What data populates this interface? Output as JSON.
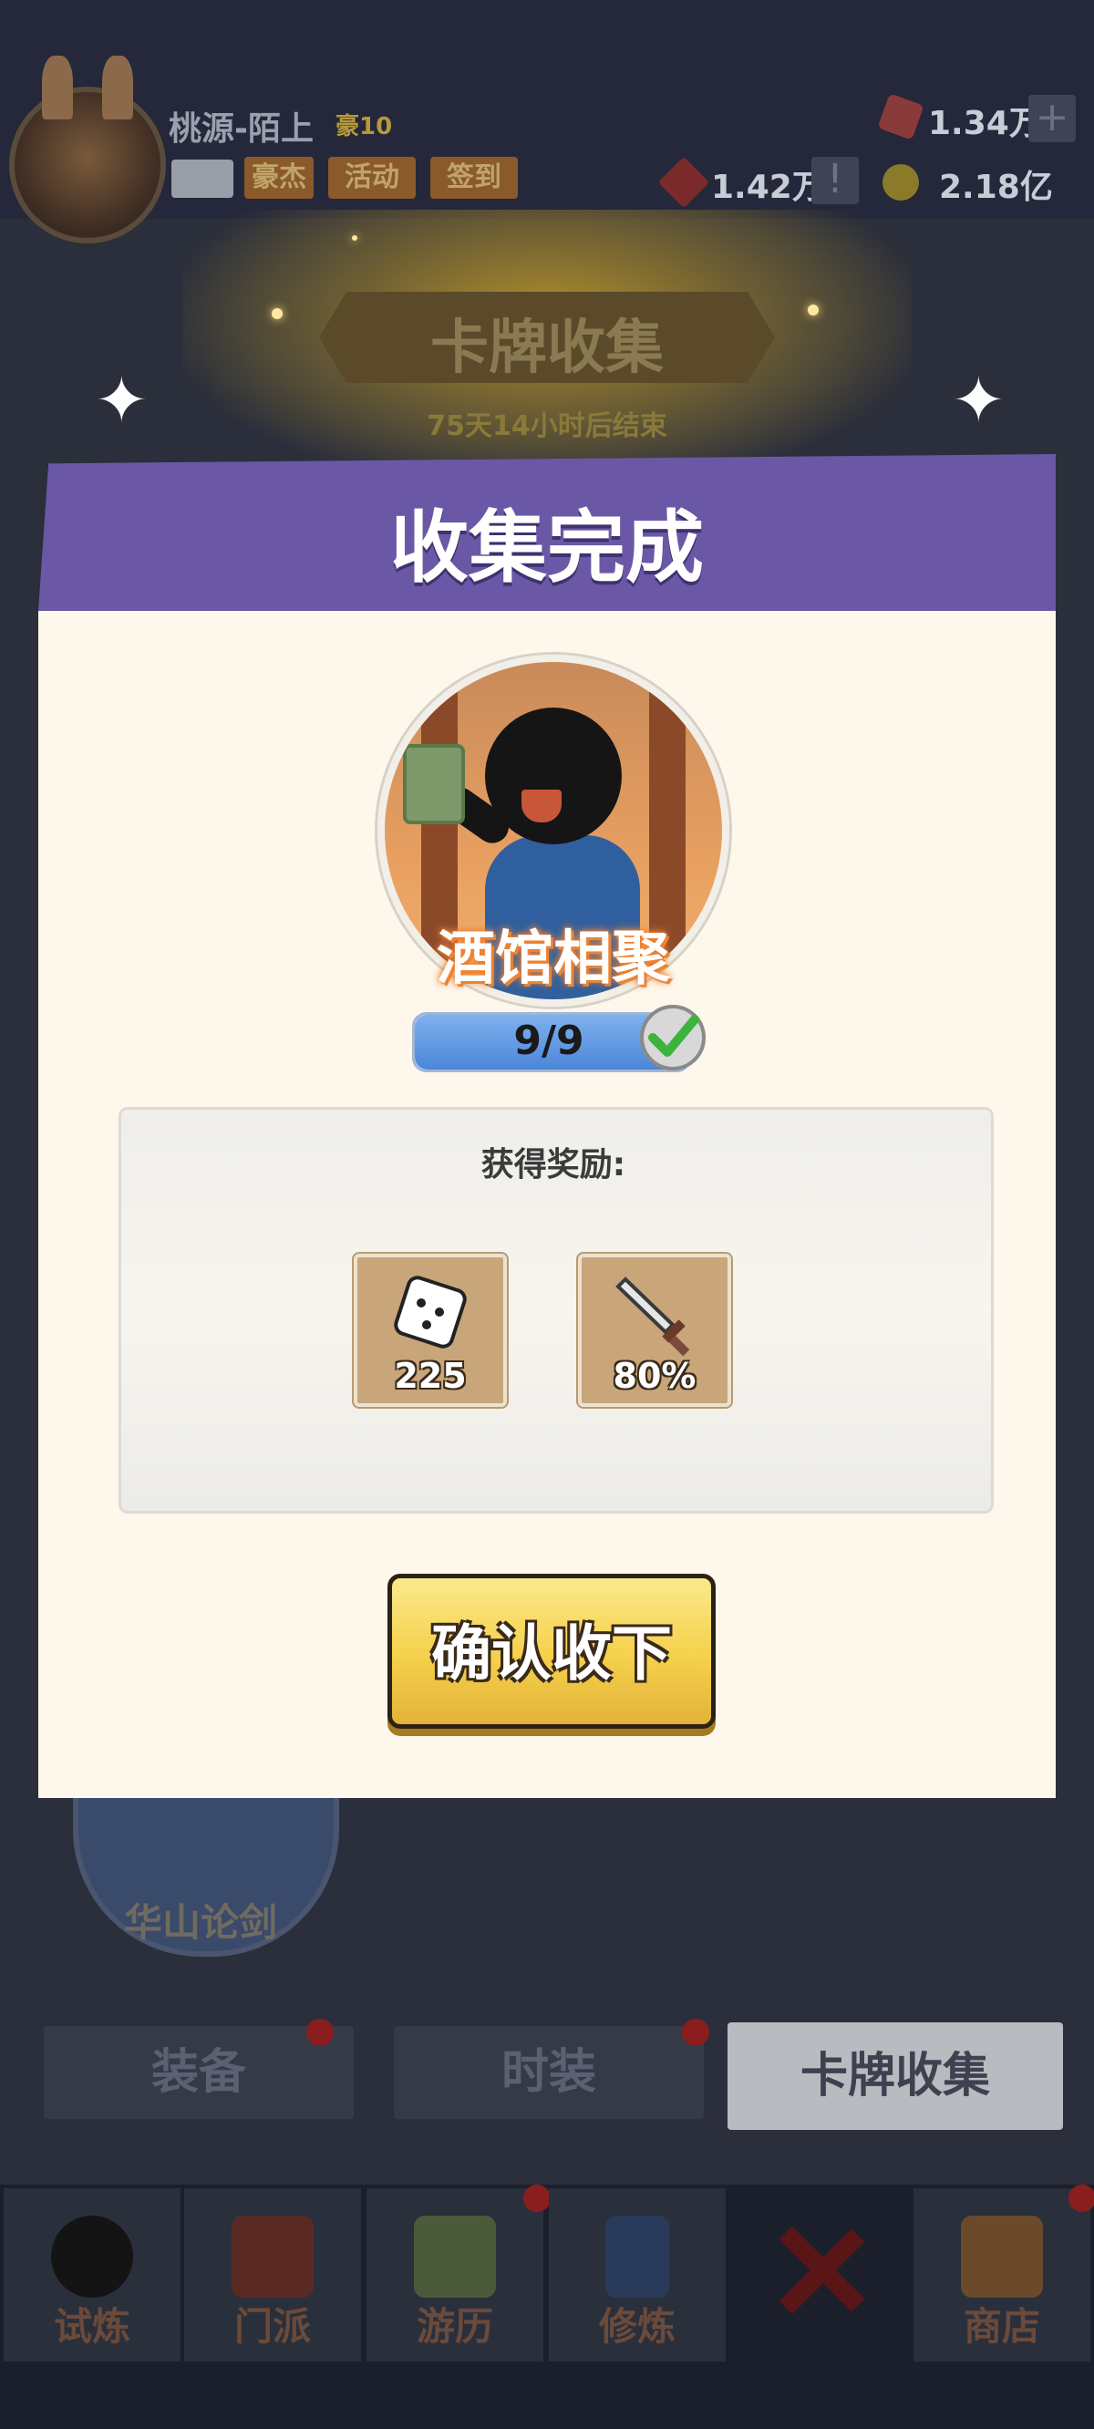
{
  "header": {
    "player_name": "桃源-陌上",
    "vip_label": "豪10",
    "tags": [
      "豪杰",
      "活动",
      "签到"
    ],
    "resources": {
      "gems": "1.34万",
      "tokens": "1.42万",
      "coins": "2.18亿",
      "plus": "+",
      "info": "!"
    }
  },
  "event": {
    "title": "卡牌收集",
    "countdown": "75天14小时后结束"
  },
  "modal": {
    "title": "收集完成",
    "card_name": "酒馆相聚",
    "progress_text": "9/9",
    "progress_fraction": 1.0,
    "reward_title": "获得奖励:",
    "rewards": [
      {
        "icon": "dice-icon",
        "value": "225"
      },
      {
        "icon": "sword-icon",
        "value": "80%"
      }
    ],
    "confirm_label": "确认收下"
  },
  "background_card": {
    "label": "华山论剑"
  },
  "subtabs": [
    "装备",
    "时装",
    "卡牌收集"
  ],
  "nav": [
    "试炼",
    "门派",
    "游历",
    "修炼",
    "",
    "商店"
  ],
  "colors": {
    "modal_header": "#6a58a6",
    "modal_body": "#fdf7ec",
    "confirm_button": "#f5d04a",
    "progress_fill": "#4b86d8",
    "check": "#3cb43c"
  }
}
